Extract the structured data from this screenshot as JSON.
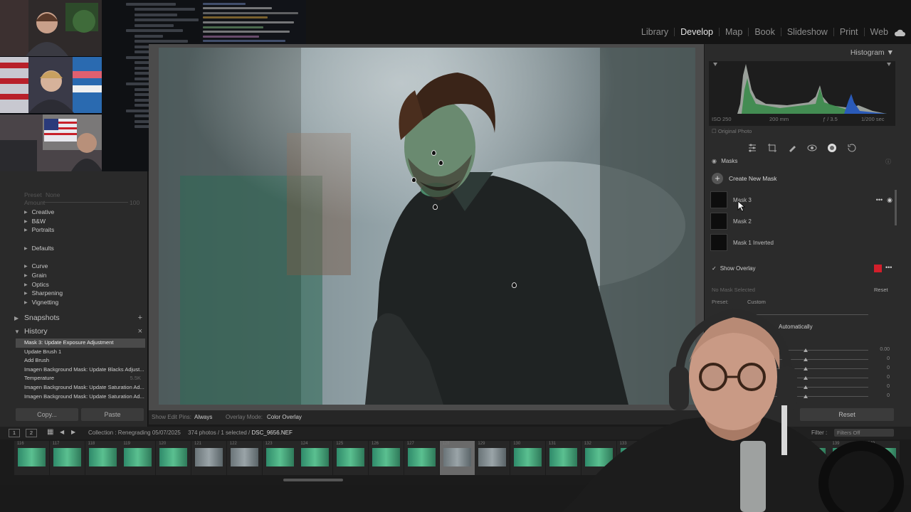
{
  "modules": [
    "Library",
    "Develop",
    "Map",
    "Book",
    "Slideshow",
    "Print",
    "Web"
  ],
  "active_module": "Develop",
  "left": {
    "preset_label": "Preset",
    "preset_value": "None",
    "amount_label": "Amount",
    "amount_value": "100",
    "preset_groups": [
      "Creative",
      "B&W",
      "Portraits",
      "Defaults",
      "Curve",
      "Grain",
      "Optics",
      "Sharpening",
      "Vignetting"
    ],
    "snapshots": "Snapshots",
    "history": "History",
    "history_items": [
      "Mask 3: Update Exposure Adjustment",
      "Update Brush 1",
      "Add Brush",
      "Imagen Background Mask: Update Blacks Adjust...",
      "Temperature",
      "Imagen Background Mask: Update Saturation Ad...",
      "Imagen Background Mask: Update Saturation Ad..."
    ],
    "temperature_value": "5.5K",
    "copy": "Copy...",
    "paste": "Paste"
  },
  "toolbar": {
    "edit_pins_label": "Show Edit Pins:",
    "edit_pins_value": "Always",
    "overlay_mode_label": "Overlay Mode:",
    "overlay_mode_value": "Color Overlay"
  },
  "right": {
    "histogram_title": "Histogram",
    "iso": "ISO 250",
    "focal": "200 mm",
    "aperture": "ƒ / 3.5",
    "shutter": "1/200 sec",
    "original_photo": "Original Photo",
    "masks_title": "Masks",
    "create_new_mask": "Create New Mask",
    "masks": [
      "Mask 3",
      "Mask 2",
      "Mask 1 Inverted"
    ],
    "show_overlay": "Show Overlay",
    "overlay_color": "#d21f2b",
    "no_mask_selected": "No Mask Selected",
    "reset_small": "Reset",
    "preset_label": "Preset:",
    "preset_value": "Custom",
    "auto_label": "Automatically",
    "slider_values": [
      "0.00",
      "0",
      "0",
      "0",
      "0",
      "0"
    ],
    "reset": "Reset"
  },
  "film": {
    "screen_1": "1",
    "screen_2": "2",
    "collection_label": "Collection : Renegrading 05/07/2025",
    "count": "374 photos / 1 selected /",
    "filename": "DSC_9656.NEF",
    "filter_label": "Filter :",
    "filter_value": "Filters Off",
    "cell_numbers": [
      "116",
      "117",
      "118",
      "119",
      "120",
      "121",
      "122",
      "123",
      "124",
      "125",
      "126",
      "127",
      "128",
      "129",
      "130",
      "131",
      "132",
      "133",
      "134",
      "135",
      "136",
      "137",
      "138",
      "139",
      "140"
    ],
    "selected_index": 12
  }
}
